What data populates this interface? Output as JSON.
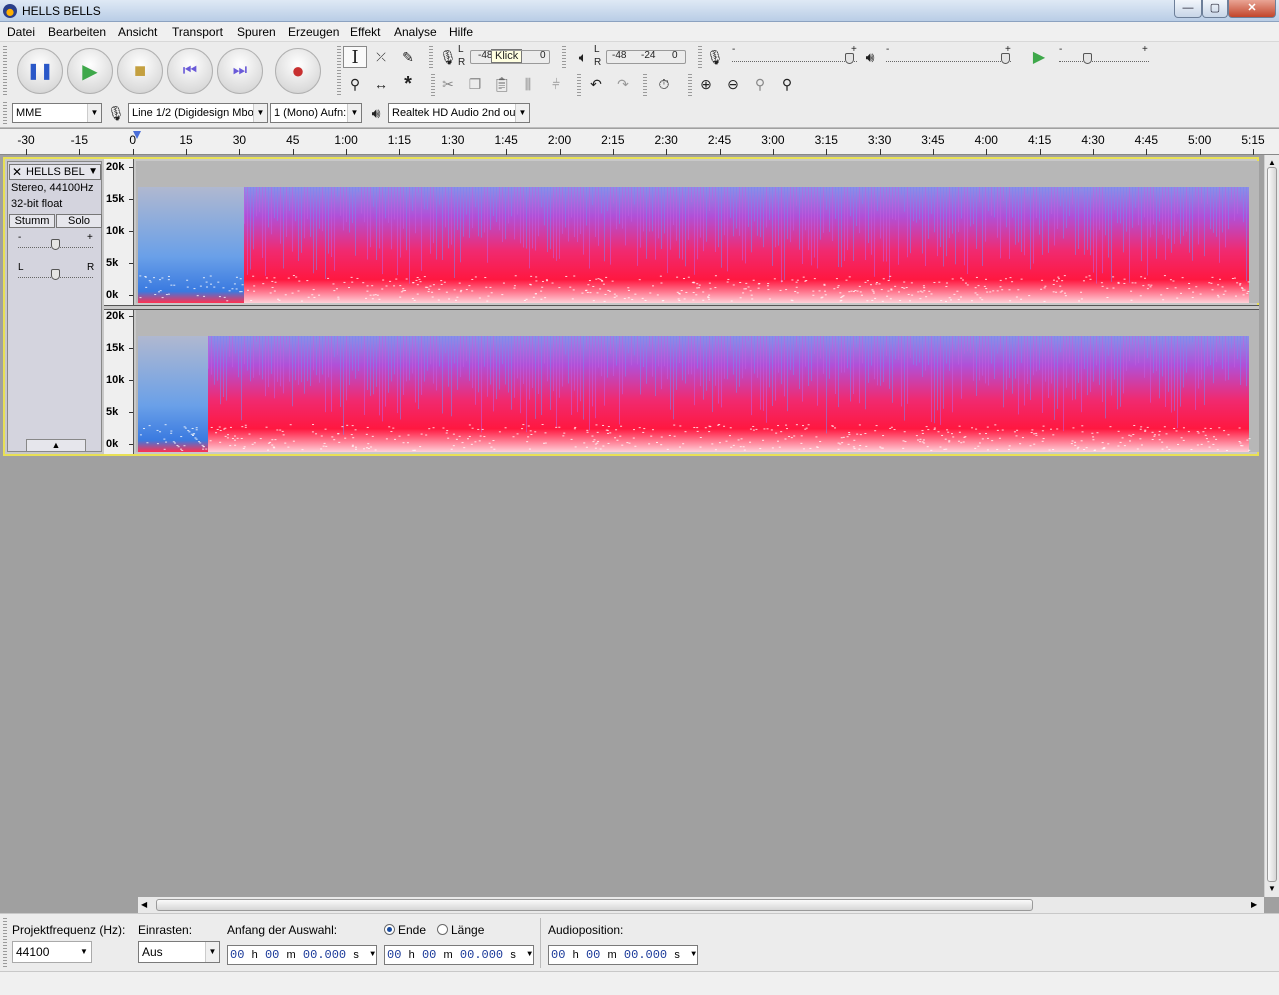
{
  "window": {
    "title": "HELLS BELLS",
    "min": "—",
    "max": "▢",
    "close": "✕"
  },
  "menu": [
    "Datei",
    "Bearbeiten",
    "Ansicht",
    "Transport",
    "Spuren",
    "Erzeugen",
    "Effekt",
    "Analyse",
    "Hilfe"
  ],
  "transport": [
    {
      "name": "pause-button",
      "glyph": "❚❚",
      "color": "#2a58c8"
    },
    {
      "name": "play-button",
      "glyph": "▶",
      "color": "#3ea84a"
    },
    {
      "name": "stop-button",
      "glyph": "■",
      "color": "#c4a040"
    },
    {
      "name": "skip-start-button",
      "glyph": "⏮",
      "color": "#6a5ad8"
    },
    {
      "name": "skip-end-button",
      "glyph": "⏭",
      "color": "#6a5ad8"
    },
    {
      "name": "record-button",
      "glyph": "●",
      "color": "#c83030"
    }
  ],
  "meters": {
    "rec_left": "L",
    "rec_right": "R",
    "rec_minus48": "-48",
    "rec_tooltip": "Klick",
    "rec_zero": "0",
    "play_left": "L",
    "play_right": "R",
    "play_minus48": "-48",
    "play_minus24": "-24",
    "play_zero": "0"
  },
  "mixer": {
    "minus": "-",
    "plus": "+"
  },
  "device": {
    "host": "MME",
    "input": "Line 1/2 (Digidesign Mbo:",
    "channels": "1 (Mono) Aufn:",
    "output": "Realtek HD Audio 2nd ou"
  },
  "ruler": [
    "-30",
    "-15",
    "0",
    "15",
    "30",
    "45",
    "1:00",
    "1:15",
    "1:30",
    "1:45",
    "2:00",
    "2:15",
    "2:30",
    "2:45",
    "3:00",
    "3:15",
    "3:30",
    "3:45",
    "4:00",
    "4:15",
    "4:30",
    "4:45",
    "5:00",
    "5:15"
  ],
  "track": {
    "name": "HELLS BEL",
    "close": "✕",
    "menu": "▼",
    "info1": "Stereo, 44100Hz",
    "info2": "32-bit float",
    "mute": "Stumm",
    "solo": "Solo",
    "gain_minus": "-",
    "gain_plus": "+",
    "pan_l": "L",
    "pan_r": "R",
    "collapse": "▲",
    "freq_labels": [
      "20k",
      "15k",
      "10k",
      "5k",
      "0k"
    ]
  },
  "selection": {
    "rate_label": "Projektfrequenz (Hz):",
    "rate_value": "44100",
    "snap_label": "Einrasten:",
    "snap_value": "Aus",
    "start_label": "Anfang der Auswahl:",
    "end_label": "Ende",
    "length_label": "Länge",
    "pos_label": "Audioposition:",
    "time_h": "00",
    "time_m": "00",
    "time_s": "00.000",
    "unit_h": "h",
    "unit_m": "m",
    "unit_s": "s"
  }
}
